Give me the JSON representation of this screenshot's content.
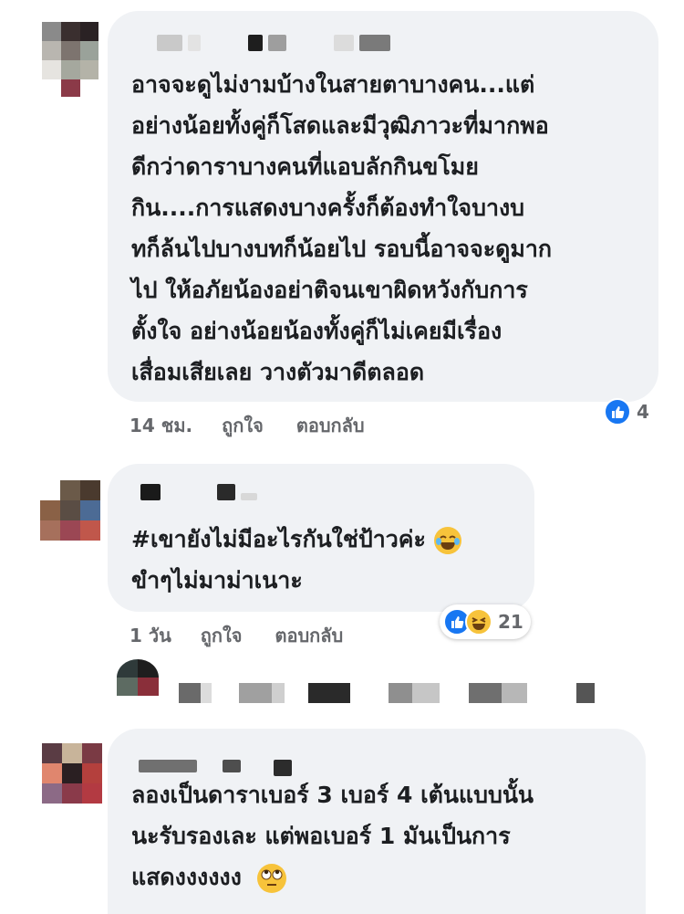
{
  "comments": [
    {
      "lines": [
        "อาจจะดูไม่งามบ้างในสายตาบางคน...แต่",
        "อย่างน้อยทั้งคู่ก็โสดและมีวุฒิภาวะที่มากพอ",
        "ดีกว่าดาราบางคนที่แอบลักกินขโมย",
        "กิน....การแสดงบางครั้งก็ต้องทำใจบางบ",
        "ทก็ล้นไปบางบทก็น้อยไป รอบนี้อาจจะดูมาก",
        "ไป ให้อภัยน้องอย่าติจนเขาผิดหวังกับการ",
        "ตั้งใจ อย่างน้อยน้องทั้งคู่ก็ไม่เคยมีเรื่อง",
        "เสื่อมเสียเลย วางตัวมาดีตลอด"
      ],
      "time": "14 ชม.",
      "like_label": "ถูกใจ",
      "reply_label": "ตอบกลับ",
      "reaction_count": "4"
    },
    {
      "lines": [
        "#เขายังไม่มีอะไรกันใช่ป้าวค่ะ",
        "ขำๆไม่มาม่าเนาะ"
      ],
      "time": "1 วัน",
      "like_label": "ถูกใจ",
      "reply_label": "ตอบกลับ",
      "reaction_count": "21",
      "inline_emoji": "face-with-tears-of-joy-icon"
    },
    {
      "lines": [
        "ลองเป็นดาราเบอร์ 3 เบอร์ 4 เต้นแบบนั้น",
        "นะรับรองเละ แต่พอเบอร์ 1 มันเป็นการ",
        "แสดงงงงงง"
      ],
      "inline_emoji": "face-with-rolling-eyes-icon"
    }
  ],
  "colors": {
    "bubble": "#f0f2f5",
    "like_blue": "#1877f2",
    "meta_gray": "#65676b",
    "text": "#1c1e21"
  }
}
